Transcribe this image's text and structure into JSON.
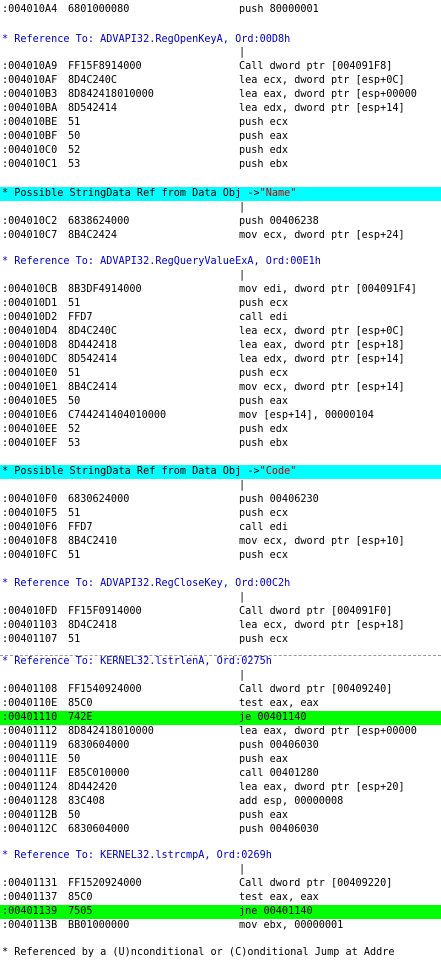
{
  "listing": {
    "ref1": "* Reference To: ADVAPI32.RegOpenKeyA, Ord:00D8h",
    "ref2": "* Reference To: ADVAPI32.RegQueryValueExA, Ord:00E1h",
    "ref3": "* Reference To: ADVAPI32.RegCloseKey, Ord:00C2h",
    "ref4": "* Reference To: KERNEL32.lstrlenA, Ord:0275h",
    "ref5": "* Reference To: KERNEL32.lstrcmpA, Ord:0269h",
    "sd1_prefix": "* Possible StringData Ref from Data Obj ->",
    "sd1_value": "\"Name\"",
    "sd2_prefix": "* Possible StringData Ref from Data Obj ->",
    "sd2_value": "\"Code\"",
    "pipe": "|",
    "footer": "* Referenced by a (U)nconditional or (C)onditional Jump at Addre",
    "lines": [
      {
        "addr": ":004010A4",
        "hex": "6801000080",
        "ins": "push 80000001"
      },
      {
        "addr": ":004010A9",
        "hex": "FF15F8914000",
        "ins": "Call dword ptr [004091F8]"
      },
      {
        "addr": ":004010AF",
        "hex": "8D4C240C",
        "ins": "lea ecx, dword ptr [esp+0C]"
      },
      {
        "addr": ":004010B3",
        "hex": "8D842418010000",
        "ins": "lea eax, dword ptr [esp+00000"
      },
      {
        "addr": ":004010BA",
        "hex": "8D542414",
        "ins": "lea edx, dword ptr [esp+14]"
      },
      {
        "addr": ":004010BE",
        "hex": "51",
        "ins": "push ecx"
      },
      {
        "addr": ":004010BF",
        "hex": "50",
        "ins": "push eax"
      },
      {
        "addr": ":004010C0",
        "hex": "52",
        "ins": "push edx"
      },
      {
        "addr": ":004010C1",
        "hex": "53",
        "ins": "push ebx"
      },
      {
        "addr": ":004010C2",
        "hex": "6838624000",
        "ins": "push 00406238"
      },
      {
        "addr": ":004010C7",
        "hex": "8B4C2424",
        "ins": "mov ecx, dword ptr [esp+24]"
      },
      {
        "addr": ":004010CB",
        "hex": "8B3DF4914000",
        "ins": "mov edi, dword ptr [004091F4]"
      },
      {
        "addr": ":004010D1",
        "hex": "51",
        "ins": "push ecx"
      },
      {
        "addr": ":004010D2",
        "hex": "FFD7",
        "ins": "call edi"
      },
      {
        "addr": ":004010D4",
        "hex": "8D4C240C",
        "ins": "lea ecx, dword ptr [esp+0C]"
      },
      {
        "addr": ":004010D8",
        "hex": "8D442418",
        "ins": "lea eax, dword ptr [esp+18]"
      },
      {
        "addr": ":004010DC",
        "hex": "8D542414",
        "ins": "lea edx, dword ptr [esp+14]"
      },
      {
        "addr": ":004010E0",
        "hex": "51",
        "ins": "push ecx"
      },
      {
        "addr": ":004010E1",
        "hex": "8B4C2414",
        "ins": "mov ecx, dword ptr [esp+14]"
      },
      {
        "addr": ":004010E5",
        "hex": "50",
        "ins": "push eax"
      },
      {
        "addr": ":004010E6",
        "hex": "C744241404010000",
        "ins": "mov [esp+14], 00000104"
      },
      {
        "addr": ":004010EE",
        "hex": "52",
        "ins": "push edx"
      },
      {
        "addr": ":004010EF",
        "hex": "53",
        "ins": "push ebx"
      },
      {
        "addr": ":004010F0",
        "hex": "6830624000",
        "ins": "push 00406230"
      },
      {
        "addr": ":004010F5",
        "hex": "51",
        "ins": "push ecx"
      },
      {
        "addr": ":004010F6",
        "hex": "FFD7",
        "ins": "call edi"
      },
      {
        "addr": ":004010F8",
        "hex": "8B4C2410",
        "ins": "mov ecx, dword ptr [esp+10]"
      },
      {
        "addr": ":004010FC",
        "hex": "51",
        "ins": "push ecx"
      },
      {
        "addr": ":004010FD",
        "hex": "FF15F0914000",
        "ins": "Call dword ptr [004091F0]"
      },
      {
        "addr": ":00401103",
        "hex": "8D4C2418",
        "ins": "lea ecx, dword ptr [esp+18]"
      },
      {
        "addr": ":00401107",
        "hex": "51",
        "ins": "push ecx"
      },
      {
        "addr": ":00401108",
        "hex": "FF1540924000",
        "ins": "Call dword ptr [00409240]"
      },
      {
        "addr": ":0040110E",
        "hex": "85C0",
        "ins": "test eax, eax"
      },
      {
        "addr": ":00401110",
        "hex": "742E",
        "ins": "je 00401140"
      },
      {
        "addr": ":00401112",
        "hex": "8D842418010000",
        "ins": "lea eax, dword ptr [esp+00000"
      },
      {
        "addr": ":00401119",
        "hex": "6830604000",
        "ins": "push 00406030"
      },
      {
        "addr": ":0040111E",
        "hex": "50",
        "ins": "push eax"
      },
      {
        "addr": ":0040111F",
        "hex": "E85C010000",
        "ins": "call 00401280"
      },
      {
        "addr": ":00401124",
        "hex": "8D442420",
        "ins": "lea eax, dword ptr [esp+20]"
      },
      {
        "addr": ":00401128",
        "hex": "83C408",
        "ins": "add esp, 00000008"
      },
      {
        "addr": ":0040112B",
        "hex": "50",
        "ins": "push eax"
      },
      {
        "addr": ":0040112C",
        "hex": "6830604000",
        "ins": "push 00406030"
      },
      {
        "addr": ":00401131",
        "hex": "FF1520924000",
        "ins": "Call dword ptr [00409220]"
      },
      {
        "addr": ":00401137",
        "hex": "85C0",
        "ins": "test eax, eax"
      },
      {
        "addr": ":00401139",
        "hex": "7505",
        "ins": "jne 00401140"
      },
      {
        "addr": ":0040113B",
        "hex": "BB01000000",
        "ins": "mov ebx, 00000001"
      }
    ]
  }
}
